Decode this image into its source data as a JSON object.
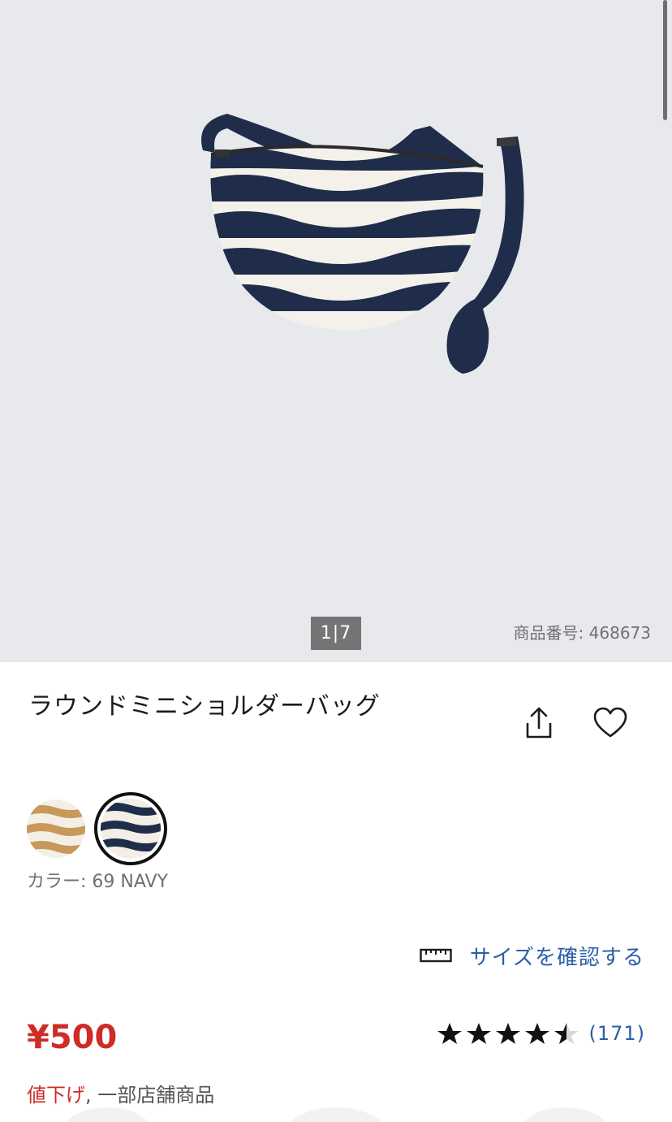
{
  "gallery": {
    "image_alt": "ラウンドミニショルダーバッグ",
    "page_indicator": "1|7",
    "product_code": "商品番号: 468673"
  },
  "product": {
    "title": "ラウンドミニショルダーバッグ",
    "share_icon": "share-icon",
    "favorite_icon": "heart-icon"
  },
  "colors": {
    "swatches": [
      {
        "name": "beige",
        "color": "#c8995a",
        "selected": false
      },
      {
        "name": "navy",
        "color": "#1f2d4a",
        "selected": true
      }
    ],
    "label_prefix": "カラー: ",
    "label_value": "69 NAVY"
  },
  "size": {
    "link_label": "サイズを確認する",
    "icon": "ruler-icon"
  },
  "price": {
    "value": "¥500",
    "note_discount": "値下げ",
    "note_separator": ", ",
    "note_rest": "一部店舗商品"
  },
  "rating": {
    "stars": 4.5,
    "review_count": "(171)"
  },
  "colors_theme": {
    "accent_red": "#cf2c27",
    "link_blue": "#2b5ea7",
    "gallery_bg": "#e8e9ed"
  }
}
